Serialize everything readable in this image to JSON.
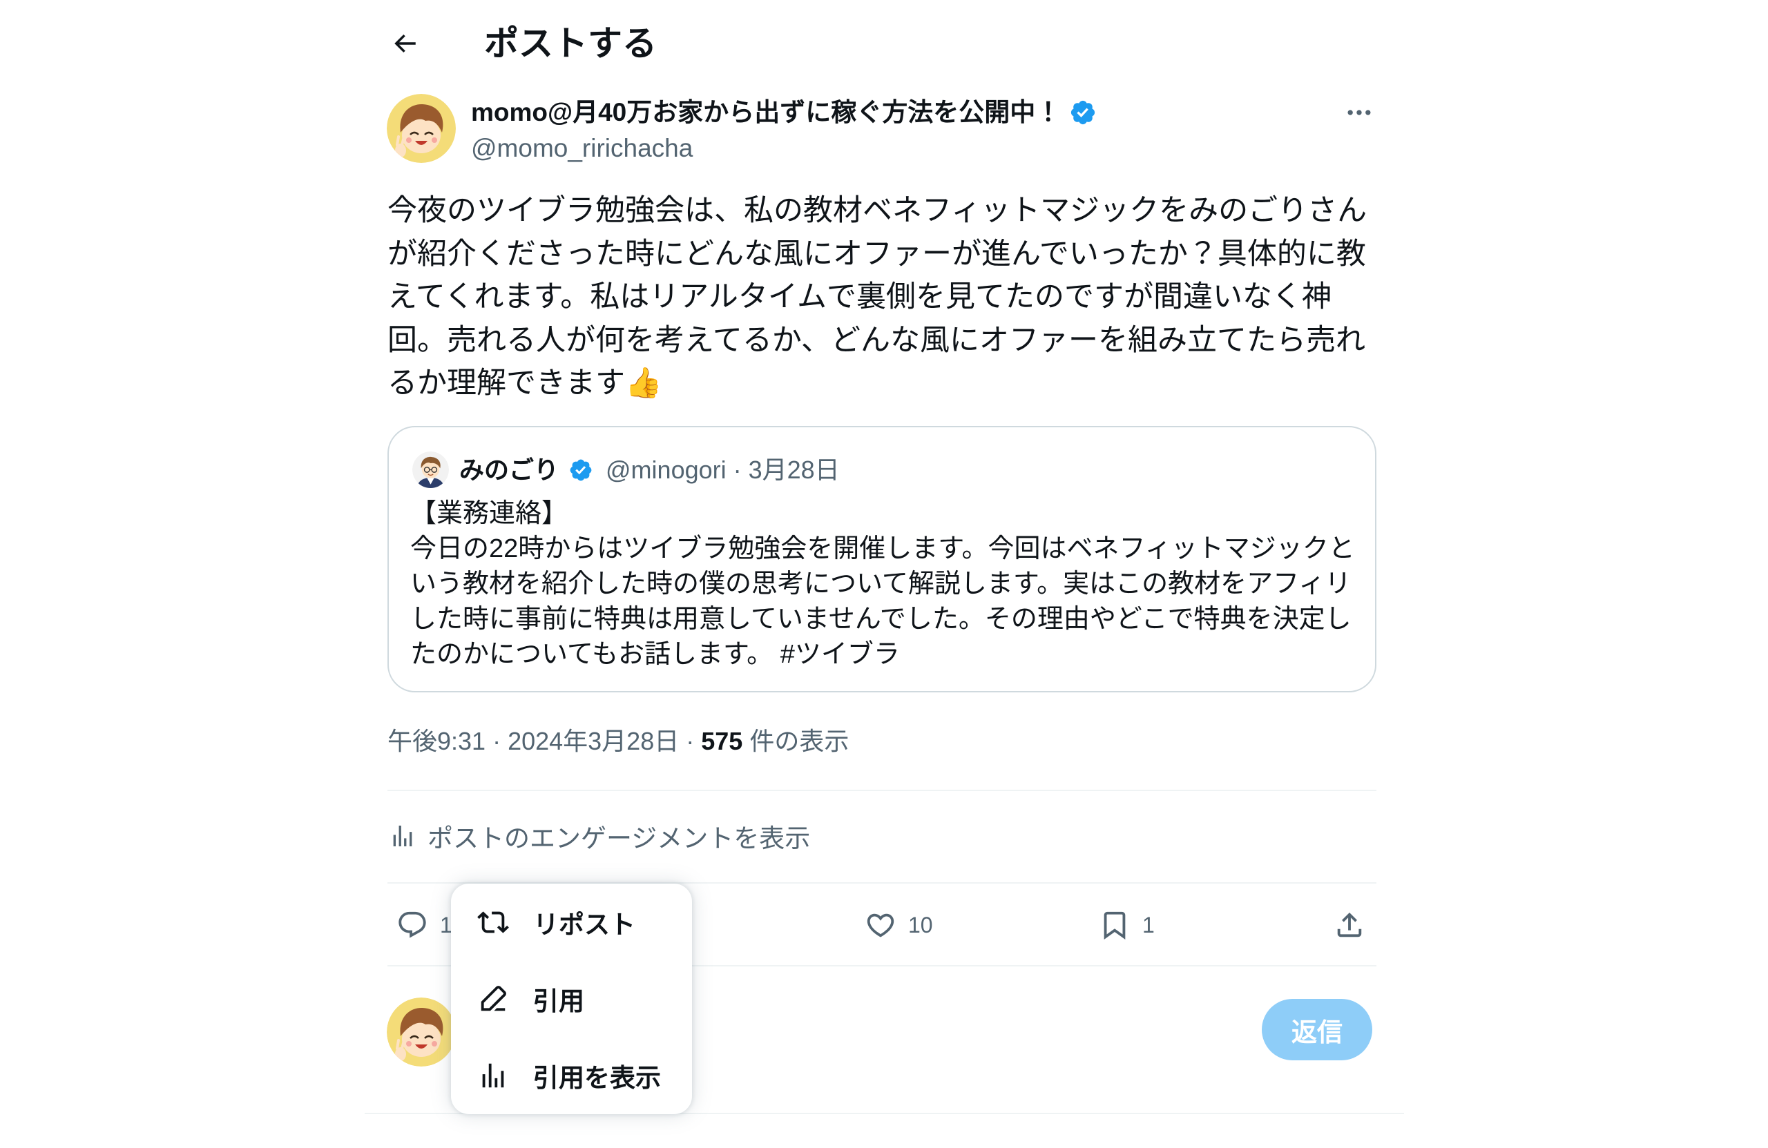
{
  "header": {
    "title": "ポストする",
    "back_icon": "arrow-left-icon"
  },
  "post": {
    "author": {
      "display_name": "momo@月40万お家から出ずに稼ぐ方法を公開中！",
      "handle": "@momo_ririchacha",
      "verified": true
    },
    "more_icon": "more-icon",
    "text": "今夜のツイブラ勉強会は、私の教材ベネフィットマジックをみのごりさんが紹介くださった時にどんな風にオファーが進んでいったか？具体的に教えてくれます。私はリアルタイムで裏側を見てたのですが間違いなく神回。売れる人が何を考えてるか、どんな風にオファーを組み立てたら売れるか理解できます👍",
    "quote": {
      "author": {
        "display_name": "みのごり",
        "handle": "@minogori",
        "verified": true
      },
      "separator": "·",
      "date": "3月28日",
      "text": "【業務連絡】\n今日の22時からはツイブラ勉強会を開催します。今回はベネフィットマジックという教材を紹介した時の僕の思考について解説します。実はこの教材をアフィリした時に事前に特典は用意していませんでした。その理由やどこで特典を決定したのかについてもお話します。 #ツイブラ"
    },
    "meta": {
      "time": "午後9:31",
      "separator": "·",
      "date": "2024年3月28日",
      "views_count": "575",
      "views_label": "件の表示"
    },
    "engagement_link": {
      "label": "ポストのエンゲージメントを表示",
      "icon": "bar-chart-icon"
    },
    "actions": {
      "reply": {
        "icon": "reply-icon",
        "count": "1"
      },
      "retweet": {
        "icon": "retweet-icon"
      },
      "like": {
        "icon": "heart-icon",
        "count": "10"
      },
      "bookmark": {
        "icon": "bookmark-icon",
        "count": "1"
      },
      "share": {
        "icon": "share-icon"
      }
    }
  },
  "reply_composer": {
    "button_label": "返信"
  },
  "repost_menu": {
    "items": [
      {
        "label": "リポスト",
        "icon": "retweet-icon"
      },
      {
        "label": "引用",
        "icon": "pencil-icon"
      },
      {
        "label": "引用を表示",
        "icon": "bar-chart-icon"
      }
    ]
  },
  "colors": {
    "text": "#0f1419",
    "muted": "#536471",
    "accent": "#1d9bf0",
    "border": "#eff3f4",
    "card_border": "#cfd9de",
    "reply_button": "#8ecdf8"
  }
}
